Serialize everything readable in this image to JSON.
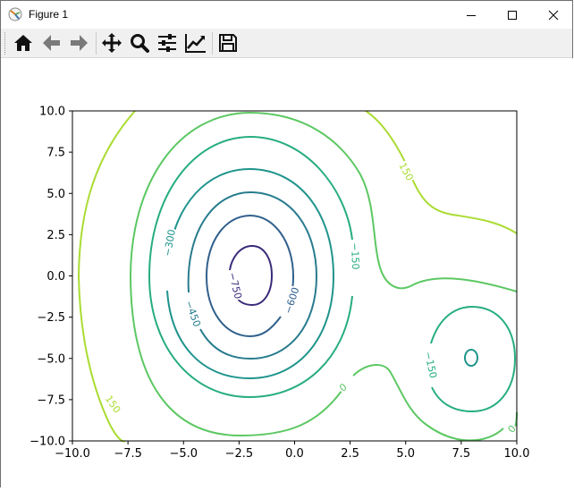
{
  "window": {
    "title": "Figure 1"
  },
  "toolbar": {
    "buttons": [
      {
        "name": "home-icon"
      },
      {
        "name": "back-arrow-icon"
      },
      {
        "name": "forward-arrow-icon"
      },
      {
        "name": "pan-move-icon"
      },
      {
        "name": "zoom-magnifier-icon"
      },
      {
        "name": "configure-subplots-icon"
      },
      {
        "name": "edit-axis-line-icon"
      },
      {
        "name": "save-floppy-icon"
      }
    ]
  },
  "colors": {
    "level_-750": "#3b2a7a",
    "level_-600": "#31608d",
    "level_-450": "#287c8e",
    "level_-300": "#1f948c",
    "level_-150": "#27ad81",
    "level_0": "#5cc863",
    "level_150": "#aadc32"
  },
  "chart_data": {
    "type": "contour",
    "xlim": [
      -10.0,
      10.0
    ],
    "ylim": [
      -10.0,
      10.0
    ],
    "xticks": [
      "−10.0",
      "−7.5",
      "−5.0",
      "−2.5",
      "0.0",
      "2.5",
      "5.0",
      "7.5",
      "10.0"
    ],
    "yticks": [
      "10.0",
      "7.5",
      "5.0",
      "2.5",
      "0.0",
      "−2.5",
      "−5.0",
      "−7.5",
      "−10.0"
    ],
    "levels": [
      -750,
      -600,
      -450,
      -300,
      -150,
      0,
      150
    ],
    "contour_labels": [
      {
        "text": "−750",
        "level": -750,
        "x": -2.7,
        "y": -0.6,
        "rotate": 76
      },
      {
        "text": "−600",
        "level": -600,
        "x": -0.1,
        "y": -1.5,
        "rotate": -72
      },
      {
        "text": "−450",
        "level": -450,
        "x": -4.6,
        "y": -2.3,
        "rotate": 70
      },
      {
        "text": "−300",
        "level": -300,
        "x": -5.6,
        "y": 2.0,
        "rotate": -80
      },
      {
        "text": "−150",
        "level": -150,
        "x": 2.7,
        "y": 1.2,
        "rotate": 88
      },
      {
        "text": "−150",
        "level": -150,
        "x": 6.1,
        "y": -5.4,
        "rotate": 78
      },
      {
        "text": "0",
        "level": 0,
        "x": 2.2,
        "y": -6.8,
        "rotate": -35
      },
      {
        "text": "0",
        "level": 0,
        "x": 9.8,
        "y": -9.3,
        "rotate": -50
      },
      {
        "text": "150",
        "level": 150,
        "x": 5.0,
        "y": 6.3,
        "rotate": 62
      },
      {
        "text": "150",
        "level": 150,
        "x": -8.2,
        "y": -7.8,
        "rotate": 55
      }
    ]
  }
}
